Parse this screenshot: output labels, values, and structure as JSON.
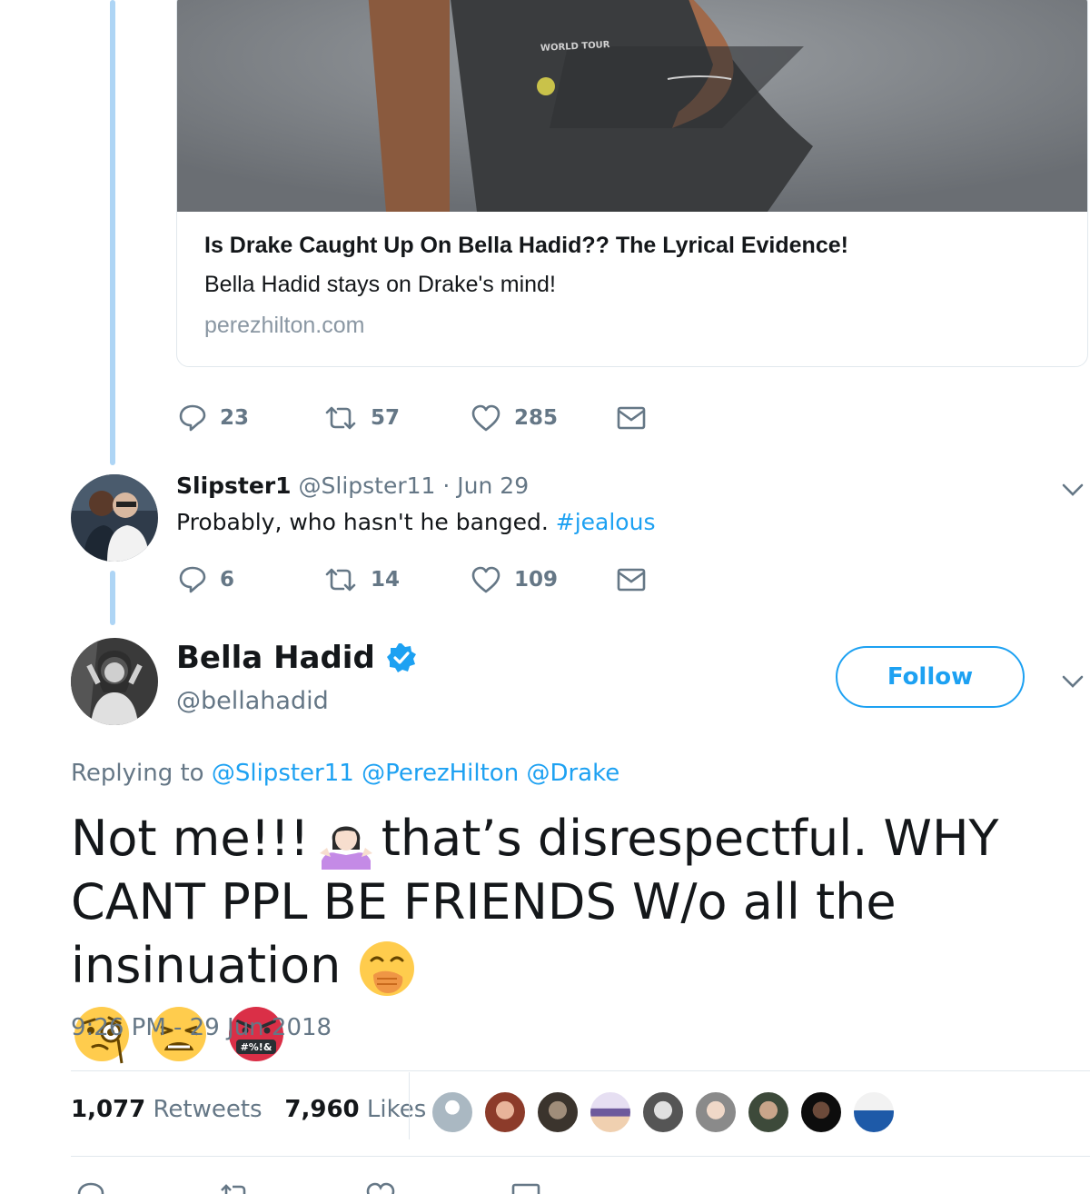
{
  "card": {
    "title": "Is Drake Caught Up On Bella Hadid?? The Lyrical Evidence!",
    "description": "Bella Hadid stays on Drake's mind!",
    "domain": "perezhilton.com",
    "shirt_text": "WORLD TOUR"
  },
  "top_tweet_actions": {
    "replies": "23",
    "retweets": "57",
    "likes": "285"
  },
  "reply_tweet": {
    "display_name": "Slipster1",
    "handle": "@Slipster11",
    "separator": " · ",
    "date": "Jun 29",
    "text": "Probably,  who hasn't he banged. ",
    "hashtag": "#jealous",
    "actions": {
      "replies": "6",
      "retweets": "14",
      "likes": "109"
    }
  },
  "main_tweet": {
    "display_name": "Bella Hadid",
    "handle": "@bellahadid",
    "follow_label": "Follow",
    "replying_prefix": "Replying to ",
    "mentions": [
      "@Slipster11",
      "@PerezHilton",
      "@Drake"
    ],
    "text_part1": "Not me!!! ",
    "text_part2": "that’s disrespectful. WHY CANT PPL BE FRIENDS W/o all the insinuation ",
    "cursing_emoji_text": "#%!&",
    "timestamp": "9:26 PM - 29 Jun 2018",
    "retweets_count": "1,077",
    "retweets_label": "Retweets",
    "likes_count": "7,960",
    "likes_label": "Likes"
  },
  "colors": {
    "accent": "#1da1f2",
    "muted": "#657786",
    "thread": "#aed5f5"
  }
}
